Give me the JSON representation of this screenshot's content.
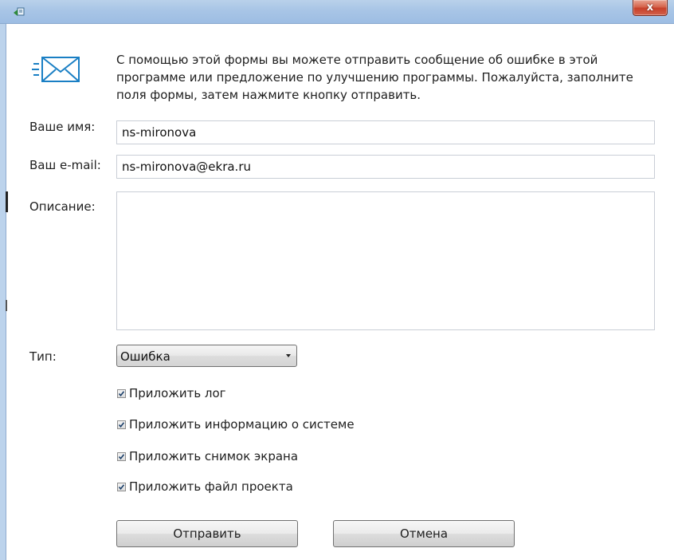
{
  "window": {
    "icon": "app-icon",
    "close_label": "x"
  },
  "intro": {
    "icon": "mail-send-icon",
    "text": "С помощью этой формы вы можете отправить сообщение об ошибке в этой программе или предложение по улучшению программы. Пожалуйста, заполните поля формы, затем нажмите кнопку отправить."
  },
  "form": {
    "name_label": "Ваше имя:",
    "name_value": "ns-mironova",
    "email_label": "Ваш e-mail:",
    "email_value": "ns-mironova@ekra.ru",
    "description_label": "Описание:",
    "description_value": "",
    "type_label": "Тип:",
    "type_selected": "Ошибка"
  },
  "checkboxes": [
    {
      "label": "Приложить лог",
      "checked": true
    },
    {
      "label": "Приложить информацию о системе",
      "checked": true
    },
    {
      "label": "Приложить снимок экрана",
      "checked": true
    },
    {
      "label": "Приложить файл проекта",
      "checked": true
    }
  ],
  "buttons": {
    "send_label": "Отправить",
    "cancel_label": "Отмена"
  },
  "colors": {
    "titlebar": "#a8c5e6",
    "close_button": "#c7402a",
    "icon_accent": "#1a7fc4"
  }
}
